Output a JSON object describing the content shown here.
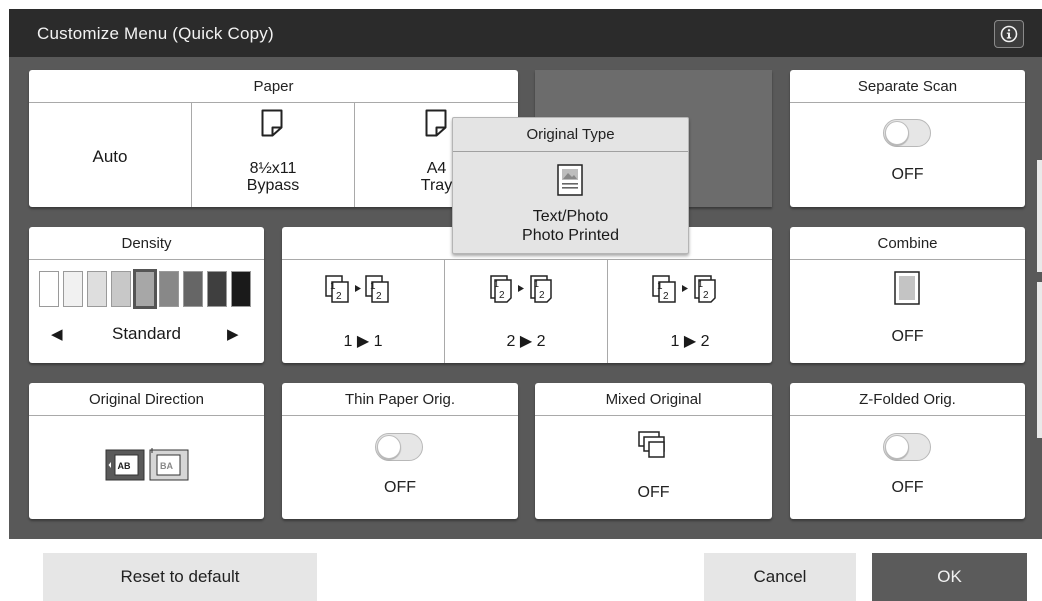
{
  "window": {
    "title": "Customize Menu (Quick Copy)",
    "info_icon": "info-icon"
  },
  "paper": {
    "title": "Paper",
    "options": [
      {
        "line1": "Auto",
        "line2": ""
      },
      {
        "line1": "8½x11",
        "line2": "Bypass",
        "icon": "paper-sheet-icon"
      },
      {
        "line1": "A4",
        "line2": "Tray",
        "icon": "paper-sheet-icon"
      }
    ]
  },
  "separate_scan": {
    "title": "Separate Scan",
    "value": "OFF"
  },
  "density": {
    "title": "Density",
    "value": "Standard",
    "level": 5,
    "levels_total": 9,
    "left_arrow": "◀",
    "right_arrow": "▶"
  },
  "duplex": {
    "options": [
      {
        "label": "1 ▶ 1",
        "icon": "simplex-to-simplex-icon"
      },
      {
        "label": "2 ▶ 2",
        "icon": "duplex-to-duplex-icon"
      },
      {
        "label": "1 ▶ 2",
        "icon": "simplex-to-duplex-icon"
      }
    ]
  },
  "combine": {
    "title": "Combine",
    "value": "OFF"
  },
  "original_direction": {
    "title": "Original Direction",
    "icon": "original-direction-icon"
  },
  "thin_paper": {
    "title": "Thin Paper Orig.",
    "value": "OFF"
  },
  "mixed_original": {
    "title": "Mixed Original",
    "value": "OFF",
    "icon": "mixed-original-icon"
  },
  "z_folded": {
    "title": "Z-Folded Orig.",
    "value": "OFF"
  },
  "original_type_popup": {
    "title": "Original Type",
    "line1": "Text/Photo",
    "line2": "Photo Printed",
    "icon": "text-photo-document-icon"
  },
  "footer": {
    "reset_label": "Reset to default",
    "cancel_label": "Cancel",
    "ok_label": "OK"
  },
  "colors": {
    "titlebar": "#2b2b2b",
    "workarea": "#595959",
    "ok_button": "#5b5b5b",
    "secondary_button": "#e6e6e6"
  }
}
